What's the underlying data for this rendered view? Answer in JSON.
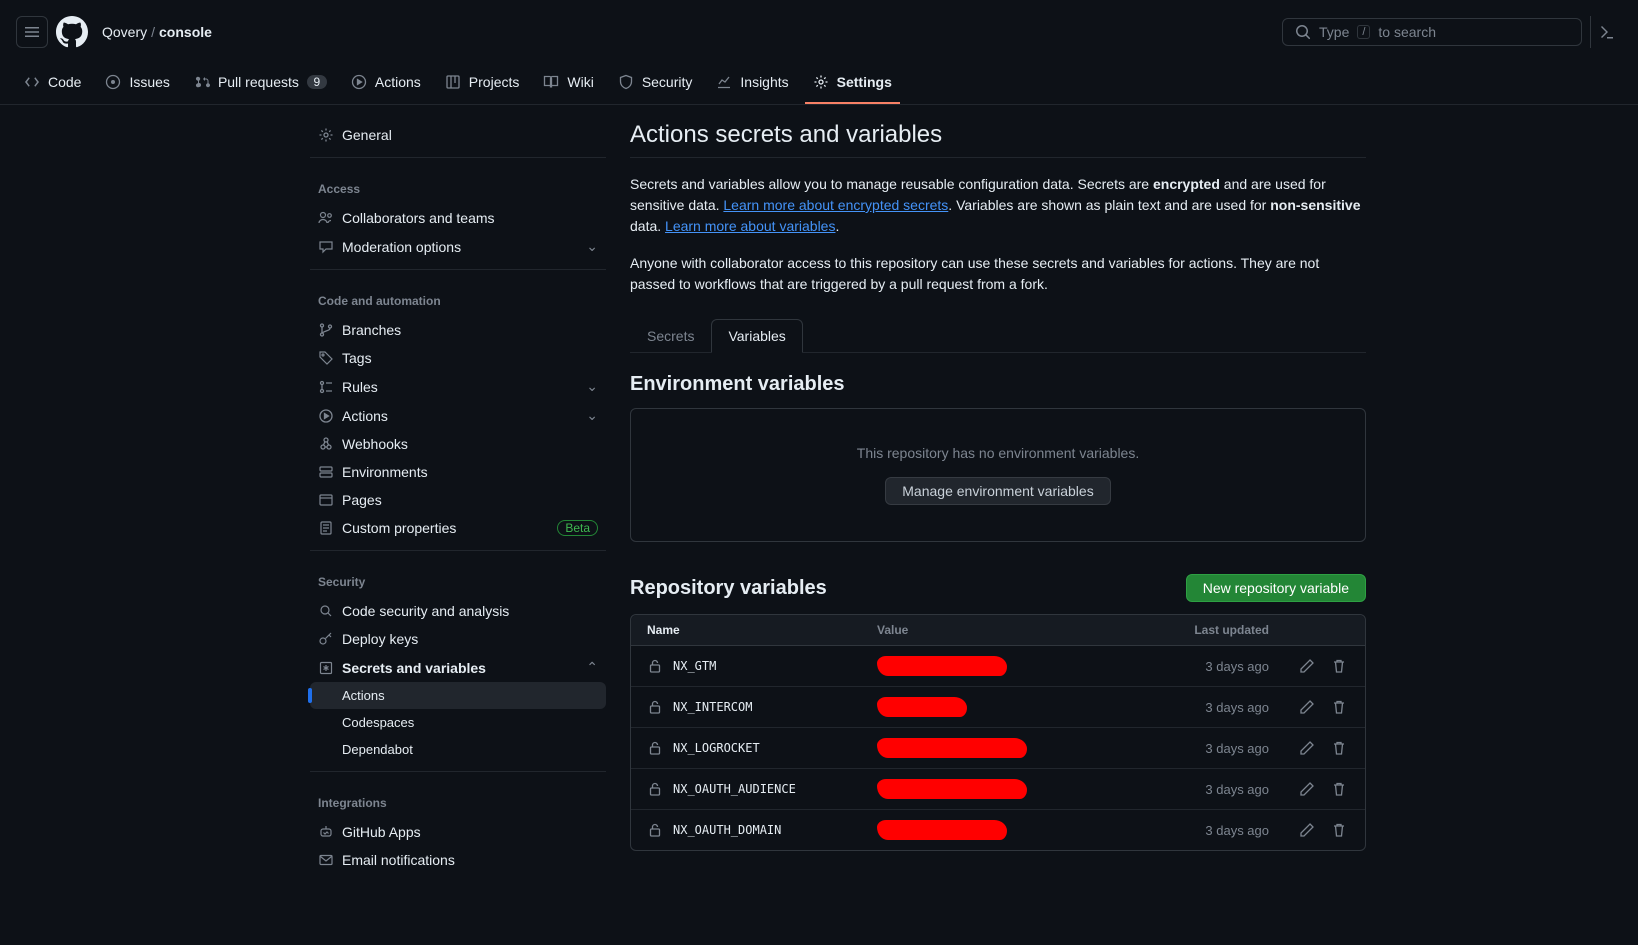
{
  "header": {
    "org": "Qovery",
    "repo": "console",
    "search_placeholder": "Type",
    "search_placeholder_after": "to search",
    "search_kbd": "/"
  },
  "nav": {
    "code": "Code",
    "issues": "Issues",
    "pulls": "Pull requests",
    "pulls_count": "9",
    "actions": "Actions",
    "projects": "Projects",
    "wiki": "Wiki",
    "security": "Security",
    "insights": "Insights",
    "settings": "Settings"
  },
  "sidebar": {
    "general": "General",
    "access_h": "Access",
    "collaborators": "Collaborators and teams",
    "moderation": "Moderation options",
    "code_h": "Code and automation",
    "branches": "Branches",
    "tags": "Tags",
    "rules": "Rules",
    "actions": "Actions",
    "webhooks": "Webhooks",
    "environments": "Environments",
    "pages": "Pages",
    "custom_props": "Custom properties",
    "beta": "Beta",
    "security_h": "Security",
    "code_security": "Code security and analysis",
    "deploy_keys": "Deploy keys",
    "secrets_vars": "Secrets and variables",
    "sub": {
      "actions": "Actions",
      "codespaces": "Codespaces",
      "dependabot": "Dependabot"
    },
    "integrations_h": "Integrations",
    "github_apps": "GitHub Apps",
    "email_notifications": "Email notifications"
  },
  "main": {
    "title": "Actions secrets and variables",
    "desc_pre": "Secrets and variables allow you to manage reusable configuration data. Secrets are ",
    "desc_enc": "encrypted",
    "desc_mid1": " and are used for sensitive data. ",
    "link_secrets": "Learn more about encrypted secrets",
    "desc_mid2": ". Variables are shown as plain text and are used for ",
    "desc_nonsens": "non-sensitive",
    "desc_mid3": " data. ",
    "link_vars": "Learn more about variables",
    "desc_end": ".",
    "desc2": "Anyone with collaborator access to this repository can use these secrets and variables for actions. They are not passed to workflows that are triggered by a pull request from a fork.",
    "subtabs": {
      "secrets": "Secrets",
      "variables": "Variables"
    },
    "env_h": "Environment variables",
    "env_msg": "This repository has no environment variables.",
    "env_btn": "Manage environment variables",
    "repo_h": "Repository variables",
    "new_btn": "New repository variable",
    "cols": {
      "name": "Name",
      "value": "Value",
      "updated": "Last updated"
    },
    "rows": [
      {
        "name": "NX_GTM",
        "updated": "3 days ago",
        "redact": ""
      },
      {
        "name": "NX_INTERCOM",
        "updated": "3 days ago",
        "redact": "w2"
      },
      {
        "name": "NX_LOGROCKET",
        "updated": "3 days ago",
        "redact": "w3"
      },
      {
        "name": "NX_OAUTH_AUDIENCE",
        "updated": "3 days ago",
        "redact": "w3"
      },
      {
        "name": "NX_OAUTH_DOMAIN",
        "updated": "3 days ago",
        "redact": ""
      }
    ]
  }
}
